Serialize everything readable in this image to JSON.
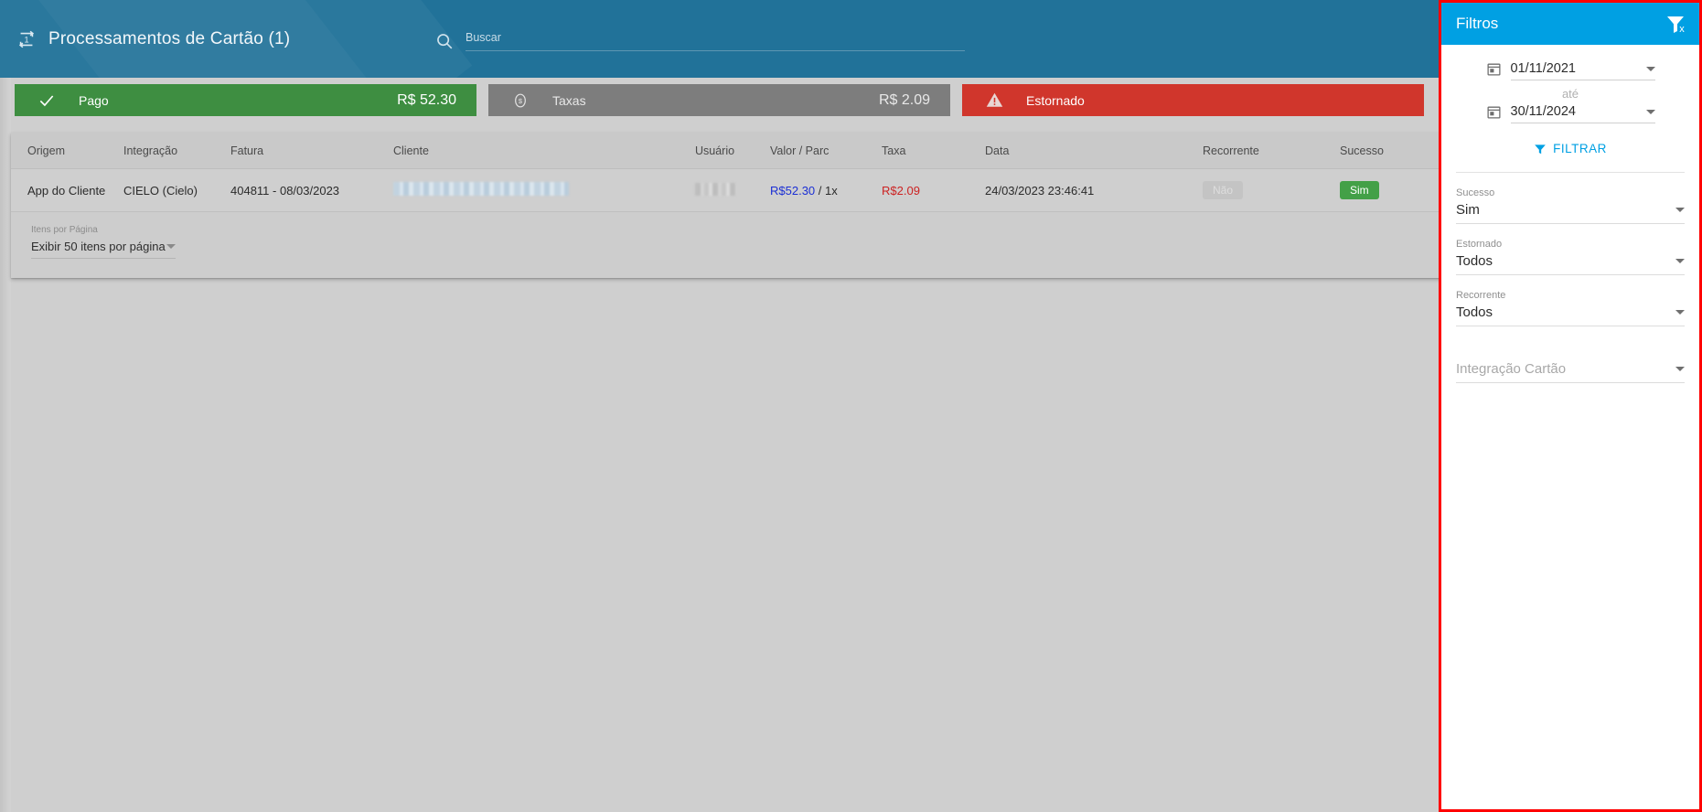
{
  "header": {
    "icon": "repeat-one-icon",
    "title": "Processamentos de Cartão (1)",
    "search": {
      "icon": "search-icon",
      "placeholder": "Buscar",
      "value": ""
    },
    "bg_color": "#217299"
  },
  "status_cards": [
    {
      "icon": "check-icon",
      "label": "Pago",
      "value": "R$ 52.30",
      "color": "#3e8e41"
    },
    {
      "icon": "coin-icon",
      "label": "Taxas",
      "value": "R$ 2.09",
      "color": "#7d7d7d"
    },
    {
      "icon": "warning-icon",
      "label": "Estornado",
      "value": "",
      "color": "#d0362c"
    }
  ],
  "table": {
    "columns": [
      "Origem",
      "Integração",
      "Fatura",
      "Cliente",
      "Usuário",
      "Valor / Parc",
      "Taxa",
      "Data",
      "Recorrente",
      "Sucesso"
    ],
    "rows": [
      {
        "origem": "App do Cliente",
        "integracao": "CIELO (Cielo)",
        "fatura": "404811 - 08/03/2023",
        "cliente": "",
        "usuario": "",
        "valor": "R$52.30",
        "parcelas": "/ 1x",
        "taxa": "R$2.09",
        "data": "24/03/2023 23:46:41",
        "recorrente": "Não",
        "sucesso": "Sim"
      }
    ],
    "colors": {
      "valor": "#1b2fd4",
      "taxa": "#cc2222",
      "sucesso_chip": "#43a047",
      "recorrente_chip": "#c4c4c4"
    }
  },
  "pagination": {
    "label": "Itens por Página",
    "value": "Exibir 50 itens por página",
    "caret_icon": "chevron-down-icon"
  },
  "filters": {
    "title": "Filtros",
    "clear_icon": "filter-remove-icon",
    "accent": "#00a0e3",
    "date_from": {
      "icon": "calendar-icon",
      "value": "01/11/2021"
    },
    "separator_label": "até",
    "date_to": {
      "icon": "calendar-icon",
      "value": "30/11/2024"
    },
    "apply_button": {
      "icon": "funnel-icon",
      "label": "FILTRAR"
    },
    "selects": [
      {
        "label": "Sucesso",
        "value": "Sim",
        "placeholder": false
      },
      {
        "label": "Estornado",
        "value": "Todos",
        "placeholder": false
      },
      {
        "label": "Recorrente",
        "value": "Todos",
        "placeholder": false
      },
      {
        "label": "",
        "value": "Integração Cartão",
        "placeholder": true
      }
    ]
  }
}
